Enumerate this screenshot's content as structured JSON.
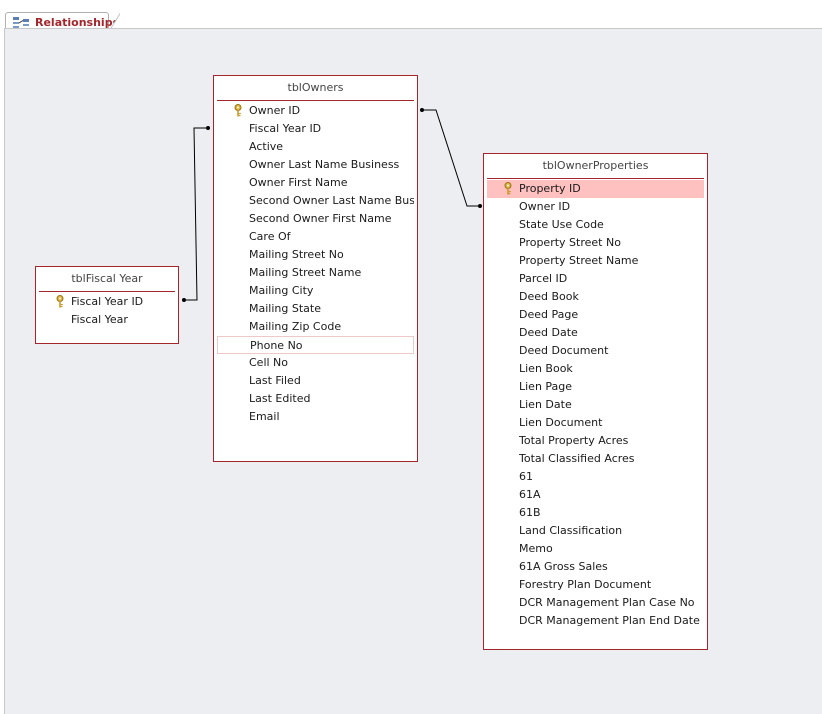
{
  "tab": {
    "label": "Relationships",
    "icon": "relationships-icon"
  },
  "colors": {
    "accent": "#a4262c",
    "selected_row": "#ffc0c0",
    "canvas": "#eceef1"
  },
  "tables": {
    "fiscal": {
      "title": "tblFiscal Year",
      "fields": [
        {
          "name": "Fiscal Year ID",
          "key": true
        },
        {
          "name": "Fiscal Year",
          "key": false
        }
      ]
    },
    "owners": {
      "title": "tblOwners",
      "fields": [
        {
          "name": "Owner ID",
          "key": true
        },
        {
          "name": "Fiscal Year ID",
          "key": false
        },
        {
          "name": "Active",
          "key": false
        },
        {
          "name": "Owner Last Name Business",
          "key": false
        },
        {
          "name": "Owner First Name",
          "key": false
        },
        {
          "name": "Second Owner Last Name Busine",
          "key": false
        },
        {
          "name": "Second Owner First Name",
          "key": false
        },
        {
          "name": "Care Of",
          "key": false
        },
        {
          "name": "Mailing Street No",
          "key": false
        },
        {
          "name": "Mailing Street Name",
          "key": false
        },
        {
          "name": "Mailing City",
          "key": false
        },
        {
          "name": "Mailing State",
          "key": false
        },
        {
          "name": "Mailing Zip Code",
          "key": false
        },
        {
          "name": "Phone No",
          "key": false,
          "focused": true
        },
        {
          "name": "Cell No",
          "key": false
        },
        {
          "name": "Last Filed",
          "key": false
        },
        {
          "name": "Last Edited",
          "key": false
        },
        {
          "name": "Email",
          "key": false
        }
      ]
    },
    "ownerprops": {
      "title": "tblOwnerProperties",
      "fields": [
        {
          "name": "Property ID",
          "key": true,
          "selected": true
        },
        {
          "name": "Owner ID",
          "key": false
        },
        {
          "name": "State Use Code",
          "key": false
        },
        {
          "name": "Property Street No",
          "key": false
        },
        {
          "name": "Property Street Name",
          "key": false
        },
        {
          "name": "Parcel ID",
          "key": false
        },
        {
          "name": "Deed Book",
          "key": false
        },
        {
          "name": "Deed Page",
          "key": false
        },
        {
          "name": "Deed Date",
          "key": false
        },
        {
          "name": "Deed Document",
          "key": false
        },
        {
          "name": "Lien Book",
          "key": false
        },
        {
          "name": "Lien Page",
          "key": false
        },
        {
          "name": "Lien Date",
          "key": false
        },
        {
          "name": "Lien Document",
          "key": false
        },
        {
          "name": "Total Property Acres",
          "key": false
        },
        {
          "name": "Total Classified Acres",
          "key": false
        },
        {
          "name": "61",
          "key": false
        },
        {
          "name": "61A",
          "key": false
        },
        {
          "name": "61B",
          "key": false
        },
        {
          "name": "Land Classification",
          "key": false
        },
        {
          "name": "Memo",
          "key": false
        },
        {
          "name": "61A Gross Sales",
          "key": false
        },
        {
          "name": "Forestry Plan Document",
          "key": false
        },
        {
          "name": "DCR Management Plan Case No",
          "key": false
        },
        {
          "name": "DCR Management Plan End Date",
          "key": false
        }
      ]
    }
  }
}
